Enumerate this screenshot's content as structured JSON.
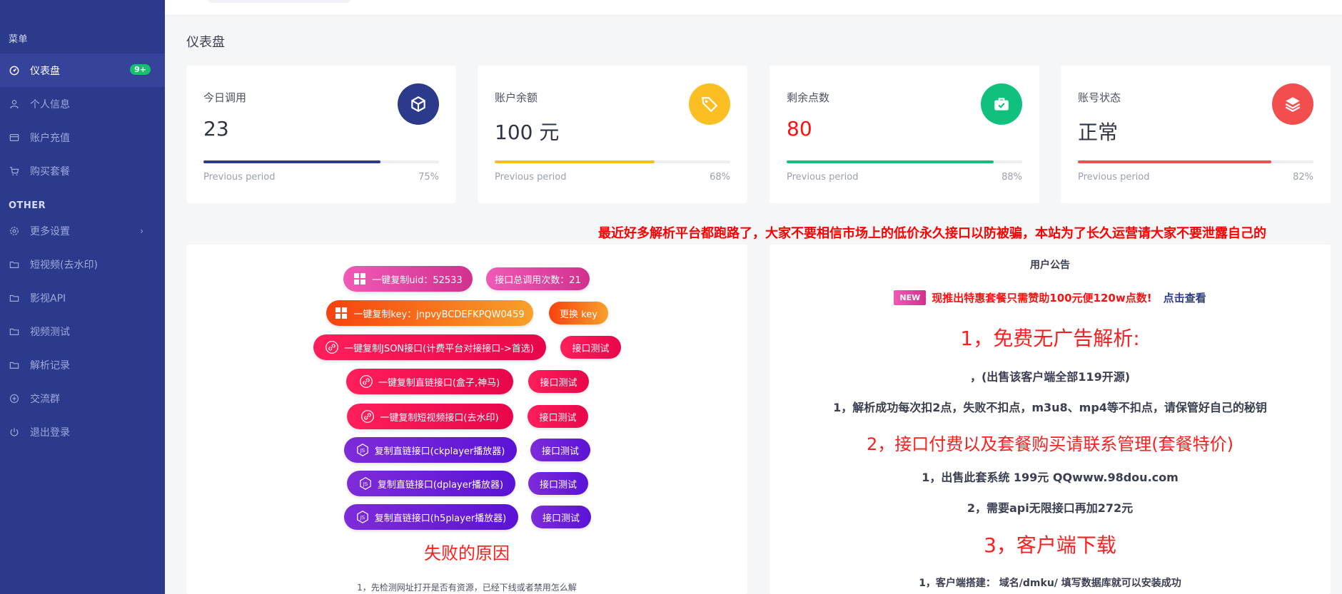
{
  "sidebar": {
    "section_menu": "菜单",
    "section_other": "OTHER",
    "items": [
      {
        "label": "仪表盘",
        "icon": "dashboard-icon",
        "badge": "9+"
      },
      {
        "label": "个人信息",
        "icon": "user-icon"
      },
      {
        "label": "账户充值",
        "icon": "card-icon"
      },
      {
        "label": "购买套餐",
        "icon": "cart-icon"
      }
    ],
    "other_items": [
      {
        "label": "更多设置",
        "icon": "gear-icon",
        "chevron": "›"
      },
      {
        "label": "短视频(去水印)",
        "icon": "folder-icon"
      },
      {
        "label": "影视API",
        "icon": "folder-icon"
      },
      {
        "label": "视频测试",
        "icon": "folder-icon"
      },
      {
        "label": "解析记录",
        "icon": "folder-icon"
      },
      {
        "label": "交流群",
        "icon": "plus-circle-icon"
      },
      {
        "label": "退出登录",
        "icon": "power-icon"
      }
    ]
  },
  "page": {
    "title": "仪表盘"
  },
  "cards": [
    {
      "label": "今日调用",
      "value": "23",
      "prev": "Previous period",
      "pct": "75%",
      "progress": 0.75,
      "color": "#2c3a8c",
      "icon": "cube-icon",
      "value_color": "#2f3446"
    },
    {
      "label": "账户余额",
      "value": "100 元",
      "prev": "Previous period",
      "pct": "68%",
      "progress": 0.68,
      "color": "#fbbf24",
      "icon": "tag-icon",
      "value_color": "#2f3446"
    },
    {
      "label": "剩余点数",
      "value": "80",
      "prev": "Previous period",
      "pct": "88%",
      "progress": 0.88,
      "color": "#10c17d",
      "icon": "briefcase-icon",
      "value_color": "#ff1010"
    },
    {
      "label": "账号状态",
      "value": "正常",
      "prev": "Previous period",
      "pct": "82%",
      "progress": 0.82,
      "color": "#f24e4e",
      "icon": "layers-icon",
      "value_color": "#2f3446"
    }
  ],
  "marquee": "最近好多解析平台都跑路了，大家不要相信市场上的低价永久接口以防被骗，本站为了长久运营请大家不要泄露自己的",
  "actions": {
    "copy_uid": "一键复制uid：52533",
    "total_calls": "接口总调用次数：21",
    "copy_key": "一键复制key：jnpvyBCDEFKPQW0459",
    "change_key": "更换 key",
    "copy_json": "一键复制JSON接口(计费平台对接接口->首选)",
    "test_json": "接口测试",
    "copy_direct": "一键复制直链接口(盒子,神马)",
    "test_direct": "接口测试",
    "copy_short": "一键复制短视频接口(去水印)",
    "test_short": "接口测试",
    "copy_ck": "复制直链接口(ckplayer播放器)",
    "test_ck": "接口测试",
    "copy_dp": "复制直链接口(dplayer播放器)",
    "test_dp": "接口测试",
    "copy_h5": "复制直链接口(h5player播放器)",
    "test_h5": "接口测试"
  },
  "fail": {
    "title": "失败的原因",
    "note": "1，先检测网址打开是否有资源，已经下线或者禁用怎么解"
  },
  "notice": {
    "title": "用户公告",
    "new_badge": "NEW",
    "promo": "现推出特惠套餐只需赞助100元便120w点数!",
    "promo_link": "点击查看",
    "h1": "1，免费无广告解析:",
    "l1": "，(出售该客户端全部119开源)",
    "l2": "1，解析成功每次扣2点，失败不扣点，m3u8、mp4等不扣点，请保管好自己的秘钥",
    "h2": "2，接口付费以及套餐购买请联系管理(套餐特价)",
    "l3": "1，出售此套系统 199元 QQwww.98dou.com",
    "l4": "2，需要api无限接口再加272元",
    "h3": "3，客户端下载",
    "l5": "1，客户端搭建：  域名/dmku/ 填写数据库就可以安装成功"
  }
}
